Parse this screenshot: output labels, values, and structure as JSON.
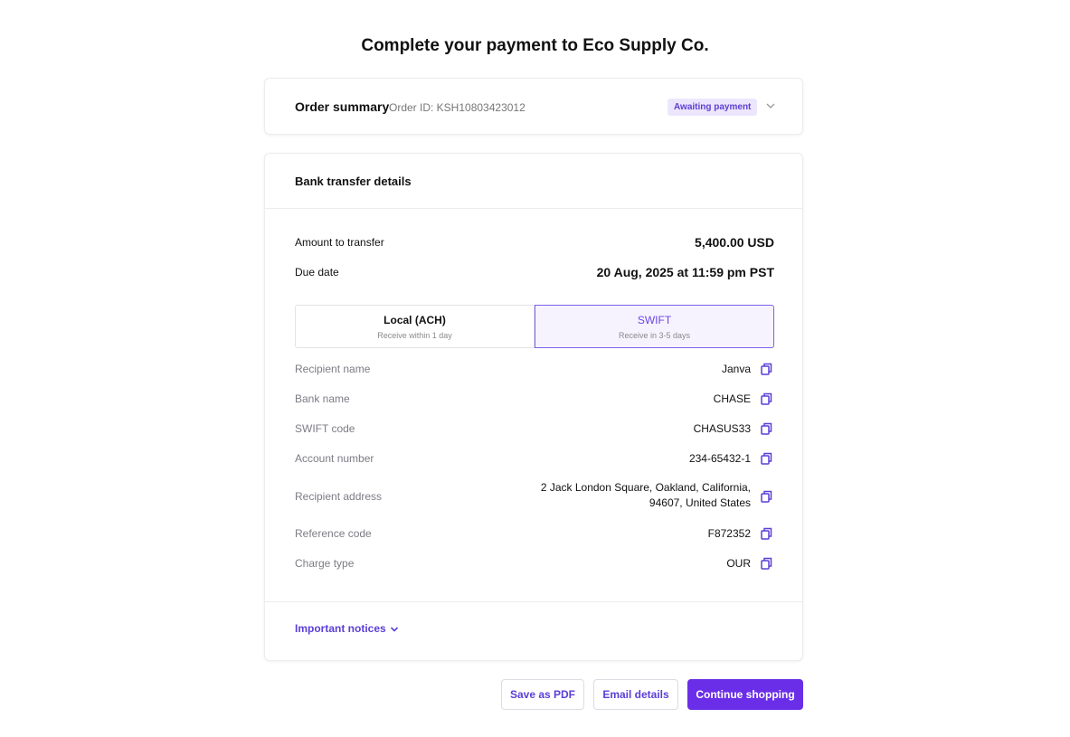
{
  "page": {
    "title": "Complete your payment to Eco Supply Co."
  },
  "summary": {
    "title": "Order summary",
    "order_id": "Order ID: KSH10803423012",
    "status": "Awaiting payment"
  },
  "bank": {
    "title": "Bank transfer details",
    "amount_label": "Amount to transfer",
    "amount_value": "5,400.00 USD",
    "due_label": "Due date",
    "due_value": "20 Aug, 2025 at 11:59 pm PST",
    "tabs": [
      {
        "label": "Local (ACH)",
        "sub": "Receive within 1 day"
      },
      {
        "label": "SWIFT",
        "sub": "Receive in 3-5 days"
      }
    ],
    "details": [
      {
        "label": "Recipient name",
        "value": "Janva"
      },
      {
        "label": "Bank name",
        "value": "CHASE"
      },
      {
        "label": "SWIFT code",
        "value": "CHASUS33"
      },
      {
        "label": "Account number",
        "value": "234-65432-1"
      },
      {
        "label": "Recipient address",
        "value_line1": "2 Jack London Square, Oakland, California,",
        "value_line2": "94607, United States"
      },
      {
        "label": "Reference code",
        "value": "F872352"
      },
      {
        "label": "Charge type",
        "value": "OUR"
      }
    ],
    "notices": "Important notices"
  },
  "actions": {
    "save_pdf": "Save as PDF",
    "email": "Email details",
    "continue": "Continue shopping"
  },
  "colors": {
    "accent": "#6b2ee8",
    "badge_bg": "#ece6fd",
    "badge_text": "#5b3fcf",
    "icons": [
      "copy-icon",
      "chevron-down-icon"
    ]
  }
}
